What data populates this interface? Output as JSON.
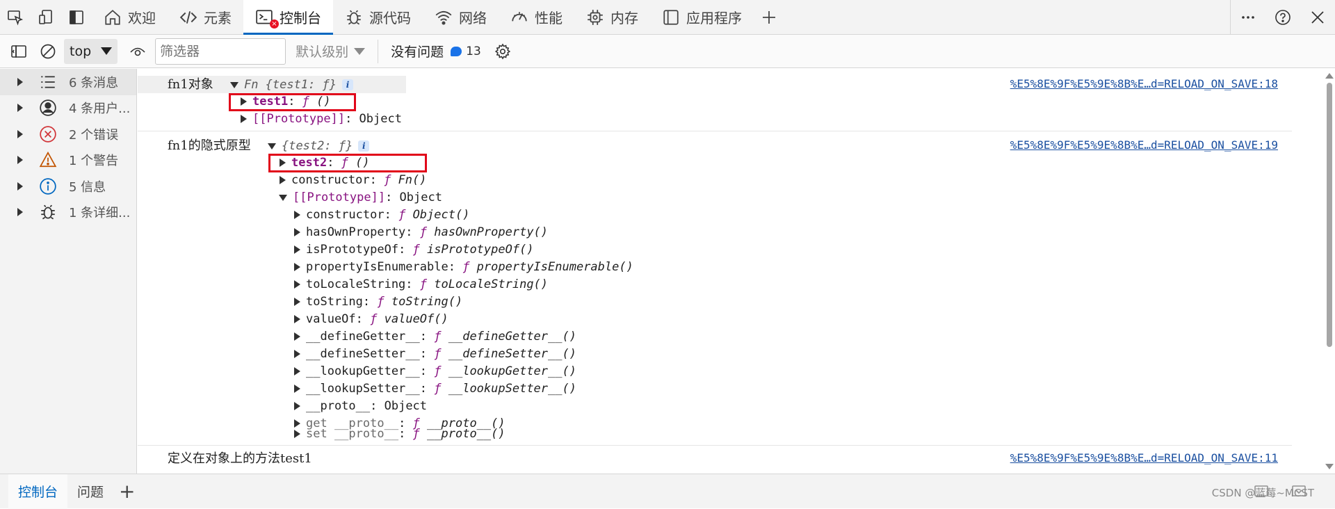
{
  "tabs": [
    {
      "label": "欢迎",
      "icon": "home-icon"
    },
    {
      "label": "元素",
      "icon": "code-icon"
    },
    {
      "label": "控制台",
      "icon": "console-icon",
      "active": true,
      "error_badge": "×"
    },
    {
      "label": "源代码",
      "icon": "bug-icon"
    },
    {
      "label": "网络",
      "icon": "wifi-icon"
    },
    {
      "label": "性能",
      "icon": "gauge-icon"
    },
    {
      "label": "内存",
      "icon": "chip-icon"
    },
    {
      "label": "应用程序",
      "icon": "app-icon"
    }
  ],
  "toolbar": {
    "context": "top",
    "filter_placeholder": "筛选器",
    "level": "默认级别",
    "issues_label": "没有问题",
    "issue_count": "13"
  },
  "sidebar": {
    "items": [
      {
        "label": "6 条消息",
        "icon": "list-icon"
      },
      {
        "label": "4 条用户...",
        "icon": "user-icon"
      },
      {
        "label": "2 个错误",
        "icon": "error-icon"
      },
      {
        "label": "1 个警告",
        "icon": "warning-icon"
      },
      {
        "label": "5 信息",
        "icon": "info-icon"
      },
      {
        "label": "1 条详细...",
        "icon": "bug-icon"
      }
    ]
  },
  "console": {
    "msg1": {
      "label": "fn1对象",
      "preview": "Fn {test1: ƒ}",
      "source": "%E5%8E%9F%E5%9E%8B%E…d=RELOAD_ON_SAVE:18",
      "rows": [
        {
          "key": "test1",
          "sep": ": ",
          "f": "ƒ",
          "val": " ()"
        },
        {
          "key": "[[Prototype]]",
          "sep": ": ",
          "val": "Object"
        }
      ]
    },
    "msg2": {
      "label": "fn1的隐式原型",
      "preview": "{test2: ƒ}",
      "source": "%E5%8E%9F%E5%9E%8B%E…d=RELOAD_ON_SAVE:19",
      "rows": [
        {
          "key": "test2",
          "sep": ": ",
          "f": "ƒ",
          "val": " ()"
        },
        {
          "key": "constructor",
          "sep": ": ",
          "f": "ƒ",
          "val": " Fn()"
        },
        {
          "key": "[[Prototype]]",
          "sep": ": ",
          "val": "Object"
        }
      ],
      "proto_rows": [
        {
          "key": "constructor",
          "sep": ": ",
          "f": "ƒ",
          "val": " Object()"
        },
        {
          "key": "hasOwnProperty",
          "sep": ": ",
          "f": "ƒ",
          "val": " hasOwnProperty()"
        },
        {
          "key": "isPrototypeOf",
          "sep": ": ",
          "f": "ƒ",
          "val": " isPrototypeOf()"
        },
        {
          "key": "propertyIsEnumerable",
          "sep": ": ",
          "f": "ƒ",
          "val": " propertyIsEnumerable()"
        },
        {
          "key": "toLocaleString",
          "sep": ": ",
          "f": "ƒ",
          "val": " toLocaleString()"
        },
        {
          "key": "toString",
          "sep": ": ",
          "f": "ƒ",
          "val": " toString()"
        },
        {
          "key": "valueOf",
          "sep": ": ",
          "f": "ƒ",
          "val": " valueOf()"
        },
        {
          "key": "__defineGetter__",
          "sep": ": ",
          "f": "ƒ",
          "val": " __defineGetter__()"
        },
        {
          "key": "__defineSetter__",
          "sep": ": ",
          "f": "ƒ",
          "val": " __defineSetter__()"
        },
        {
          "key": "__lookupGetter__",
          "sep": ": ",
          "f": "ƒ",
          "val": " __lookupGetter__()"
        },
        {
          "key": "__lookupSetter__",
          "sep": ": ",
          "f": "ƒ",
          "val": " __lookupSetter__()"
        },
        {
          "key": "__proto__",
          "sep": ": ",
          "val": "Object"
        },
        {
          "key": "get __proto__",
          "sep": ": ",
          "f": "ƒ",
          "val": " __proto__()"
        },
        {
          "key": "set __proto__",
          "sep": ": ",
          "f": "ƒ",
          "val": " __proto__()"
        }
      ]
    },
    "msg3": {
      "label": "定义在对象上的方法test1",
      "source": "%E5%8E%9F%E5%9E%8B%E…d=RELOAD_ON_SAVE:11"
    }
  },
  "drawer": {
    "tabs": [
      "控制台",
      "问题"
    ],
    "add": "+",
    "watermark": "CSDN @蓝莓~MCST"
  },
  "colors": {
    "accent": "#0067c0",
    "highlight_box": "#e1061a",
    "key_purple": "#881280",
    "link": "#1a4fa0"
  }
}
